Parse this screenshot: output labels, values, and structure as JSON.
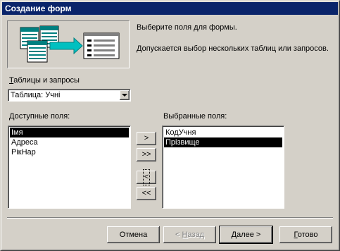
{
  "window": {
    "title": "Создание форм"
  },
  "intro": {
    "line1": "Выберите поля для формы.",
    "line2": "Допускается выбор нескольких таблиц или запросов."
  },
  "source": {
    "label_prefix": "",
    "label_accel": "Т",
    "label_rest": "аблицы и запросы",
    "selected": "Таблица: Учні"
  },
  "available": {
    "label_accel": "Д",
    "label_rest": "оступные поля:",
    "items": [
      {
        "text": "Імя",
        "selected": true
      },
      {
        "text": "Адреса",
        "selected": false
      },
      {
        "text": "РікНар",
        "selected": false
      }
    ]
  },
  "chosen": {
    "label": "Выбранные поля:",
    "items": [
      {
        "text": "КодУчня",
        "selected": false
      },
      {
        "text": "Прізвище",
        "selected": true
      }
    ]
  },
  "move_buttons": {
    "add_one": ">",
    "add_all": ">>",
    "remove_one": "<",
    "remove_all": "<<"
  },
  "footer": {
    "cancel": "Отмена",
    "back_prefix": "< ",
    "back_accel": "Н",
    "back_rest": "азад",
    "next_accel": "Д",
    "next_rest": "алее >",
    "finish_accel": "Г",
    "finish_rest": "отово"
  },
  "colors": {
    "title_bar": "#0a246a",
    "face": "#d4d0c8",
    "arrow": "#00c0c0",
    "table_header": "#008080"
  }
}
